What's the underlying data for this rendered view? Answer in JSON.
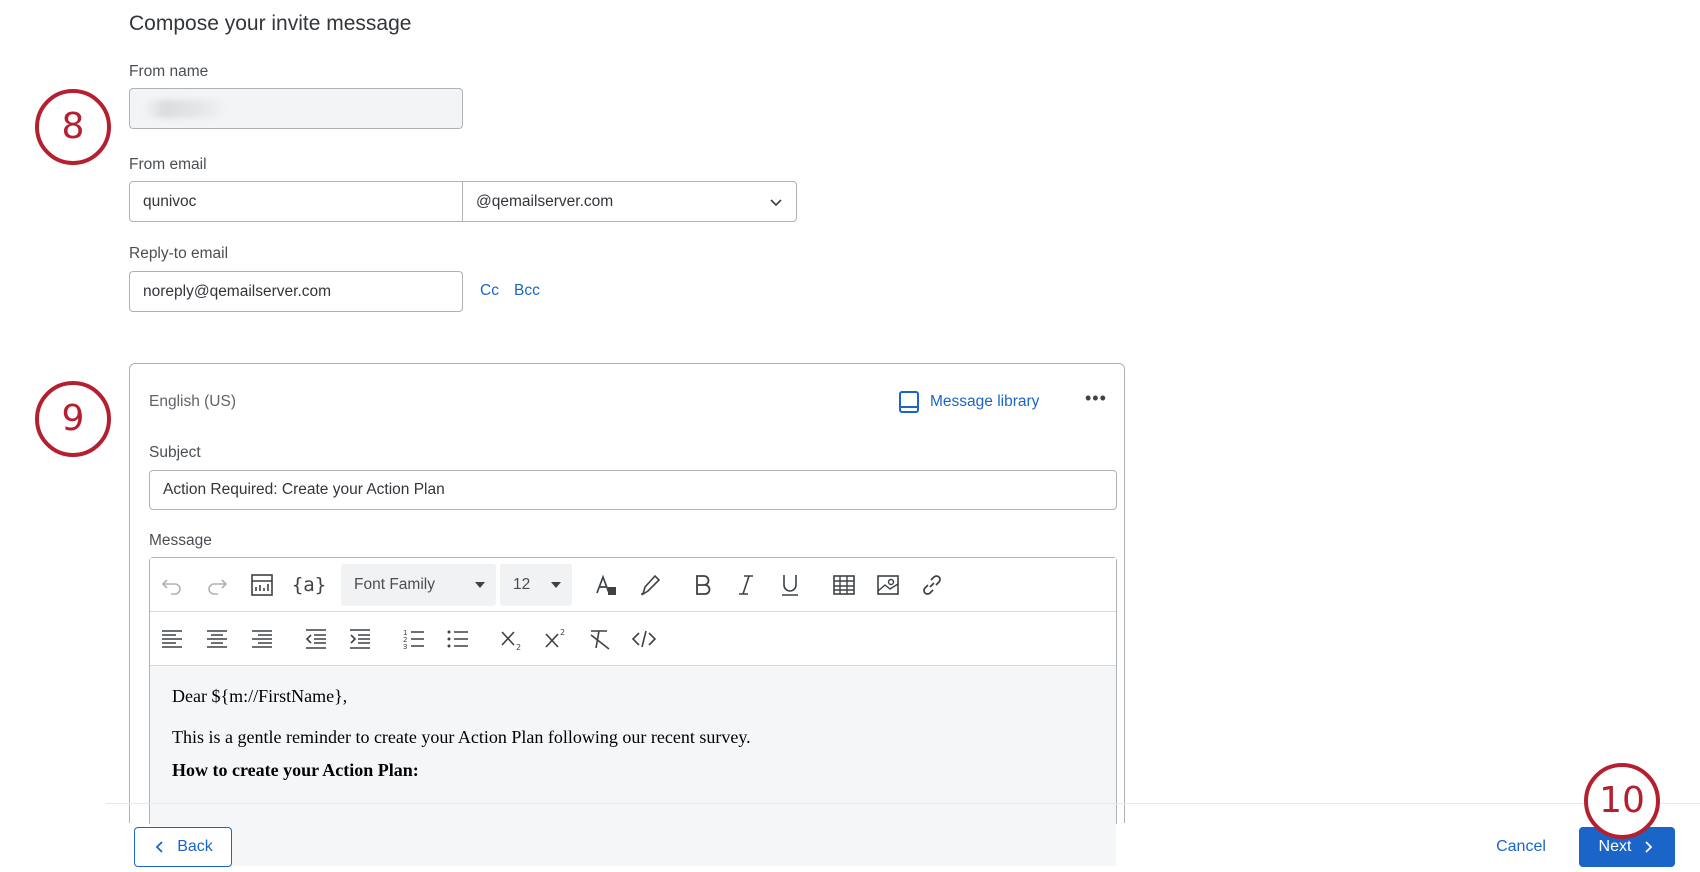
{
  "section": {
    "title": "Compose your invite message"
  },
  "from_name": {
    "label": "From name",
    "value": ""
  },
  "from_email": {
    "label": "From email",
    "local_part": "qunivoc",
    "domain_selected": "@qemailserver.com"
  },
  "reply_to": {
    "label": "Reply-to email",
    "value": "noreply@qemailserver.com",
    "cc_label": "Cc",
    "bcc_label": "Bcc"
  },
  "message_card": {
    "language": "English (US)",
    "library_label": "Message library",
    "more_label": "•••",
    "subject_label": "Subject",
    "subject_value": "Action Required: Create your Action Plan",
    "message_label": "Message"
  },
  "toolbar": {
    "font_family": "Font Family",
    "font_size": "12",
    "icons_row1": [
      "undo-icon",
      "redo-icon",
      "insert-graph-icon",
      "piped-text-icon",
      "font-color-icon",
      "highlight-icon",
      "bold-icon",
      "italic-icon",
      "underline-icon",
      "table-icon",
      "insert-image-icon",
      "link-icon"
    ],
    "icons_row2": [
      "align-left-icon",
      "align-center-icon",
      "align-right-icon",
      "outdent-icon",
      "indent-icon",
      "numbered-list-icon",
      "bulleted-list-icon",
      "subscript-icon",
      "superscript-icon",
      "clear-format-icon",
      "source-code-icon"
    ]
  },
  "body": {
    "greeting": "Dear ${m://FirstName},",
    "line1": "This is a gentle reminder to create your Action Plan following our recent survey.",
    "heading": "How to create your Action Plan:"
  },
  "footer": {
    "back_label": "Back",
    "cancel_label": "Cancel",
    "next_label": "Next"
  },
  "markers": {
    "m8": "8",
    "m9": "9",
    "m10": "10"
  },
  "colors": {
    "accent": "#1a65c7",
    "marker": "#b52031",
    "border": "#aeb3b8"
  }
}
